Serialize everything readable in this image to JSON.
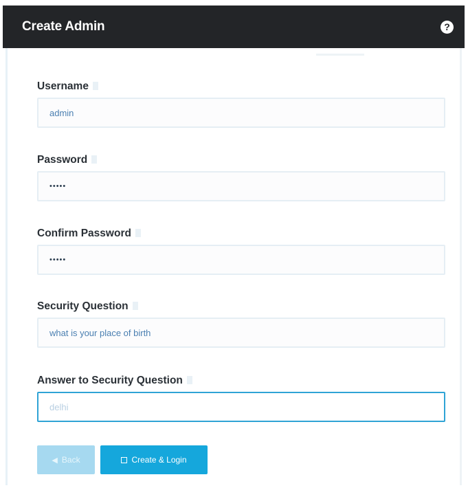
{
  "header": {
    "title": "Create Admin",
    "help_icon": "?"
  },
  "form": {
    "username": {
      "label": "Username",
      "value": "admin"
    },
    "password": {
      "label": "Password",
      "value": "•••••"
    },
    "confirm_password": {
      "label": "Confirm Password",
      "value": "•••••"
    },
    "security_question": {
      "label": "Security Question",
      "value": "what is your place of birth"
    },
    "security_answer": {
      "label": "Answer to Security Question",
      "value": "delhi"
    }
  },
  "buttons": {
    "back_label": "Back",
    "back_icon": "◀",
    "create_label": "Create & Login",
    "create_icon": "save-icon"
  },
  "colors": {
    "header_bg": "#232528",
    "primary": "#15a7dc",
    "primary_disabled": "#a6d9f0",
    "focus_border": "#2fa3d5"
  }
}
